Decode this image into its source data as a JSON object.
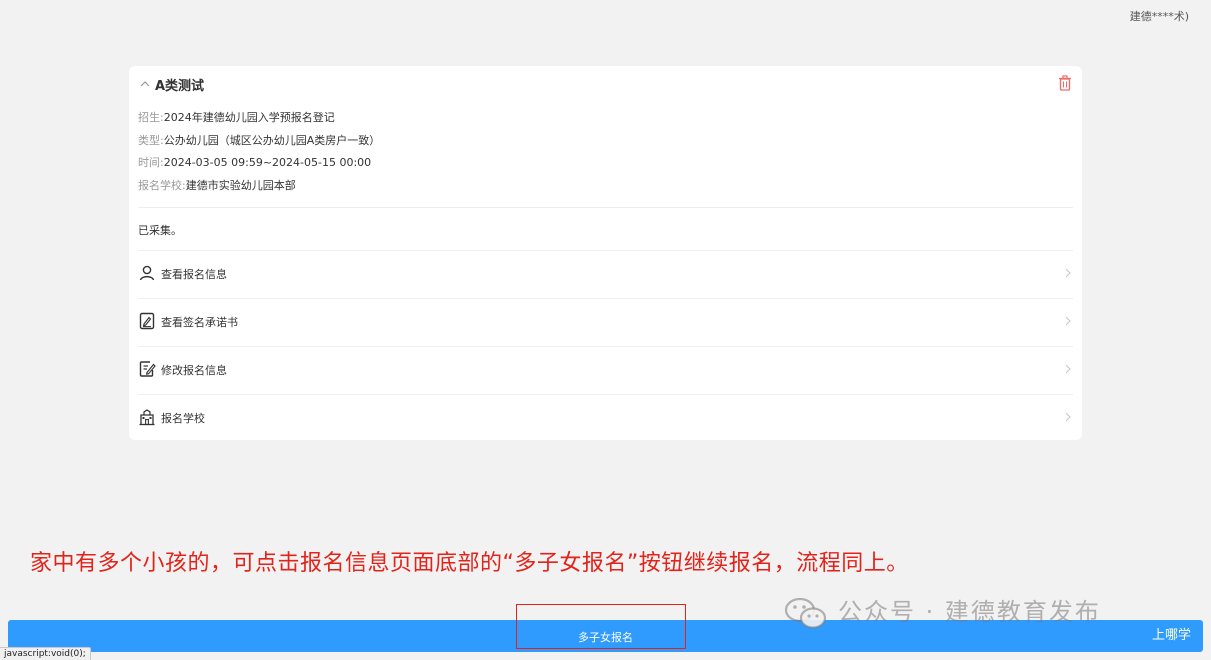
{
  "header": {
    "user": "建德****术)"
  },
  "card": {
    "title": "A类测试",
    "info": [
      {
        "label": "招生:",
        "value": "2024年建德幼儿园入学预报名登记"
      },
      {
        "label": "类型:",
        "value": "公办幼儿园（城区公办幼儿园A类房户一致）"
      },
      {
        "label": "时间:",
        "value": "2024-03-05 09:59~2024-05-15 00:00"
      },
      {
        "label": "报名学校:",
        "value": "建德市实验幼儿园本部"
      }
    ],
    "status": "已采集。",
    "menu": [
      {
        "label": "查看报名信息",
        "icon": "person-icon"
      },
      {
        "label": "查看签名承诺书",
        "icon": "signature-icon"
      },
      {
        "label": "修改报名信息",
        "icon": "edit-icon"
      },
      {
        "label": "报名学校",
        "icon": "school-icon"
      }
    ]
  },
  "annotation": "家中有多个小孩的，可点击报名信息页面底部的“多子女报名”按钮继续报名，流程同上。",
  "bottom_button": {
    "label": "多子女报名"
  },
  "watermark": {
    "text": "公众号 · 建德教育发布",
    "sub": "上哪学"
  },
  "status_bar": {
    "text": "javascript:void(0);"
  },
  "colors": {
    "primary": "#2f9bff",
    "annotation": "#e2231a",
    "delete": "#f06a6a",
    "background": "#f2f2f2"
  }
}
